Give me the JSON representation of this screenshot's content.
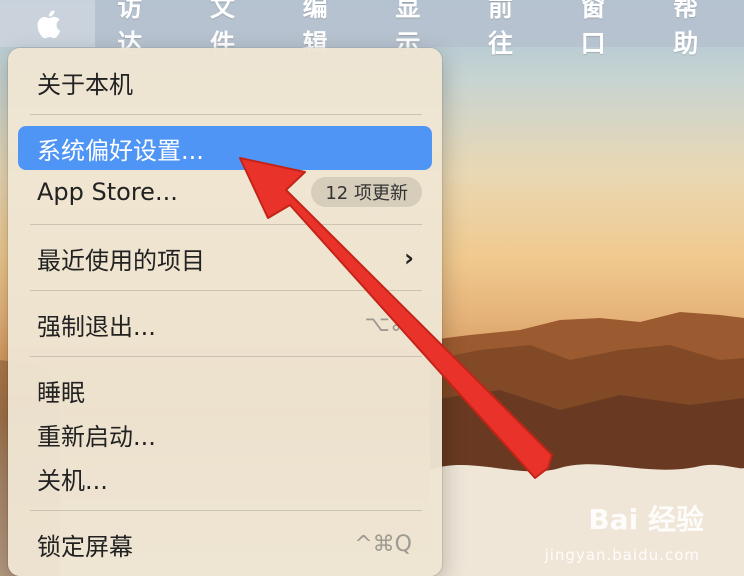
{
  "menubar": {
    "apple_icon": "apple-logo-icon",
    "items": [
      "访达",
      "文件",
      "编辑",
      "显示",
      "前往",
      "窗口",
      "帮助"
    ]
  },
  "apple_menu": {
    "items": {
      "about": "关于本机",
      "prefs": "系统偏好设置...",
      "appstore": "App Store...",
      "appstore_badge": "12 项更新",
      "recent": "最近使用的项目",
      "forcequit": "强制退出...",
      "forcequit_shortcut": "⌥⌘",
      "sleep": "睡眠",
      "restart": "重新启动...",
      "shutdown": "关机...",
      "lock": "锁定屏幕",
      "lock_shortcut": "^⌘Q"
    },
    "selected": "系统偏好设置..."
  },
  "annotation": {
    "arrow_color": "#e8322a"
  },
  "watermark": {
    "line1": "Bai 经验",
    "line2": "jingyan.baidu.com"
  },
  "colors": {
    "selection": "#4f95f6"
  }
}
